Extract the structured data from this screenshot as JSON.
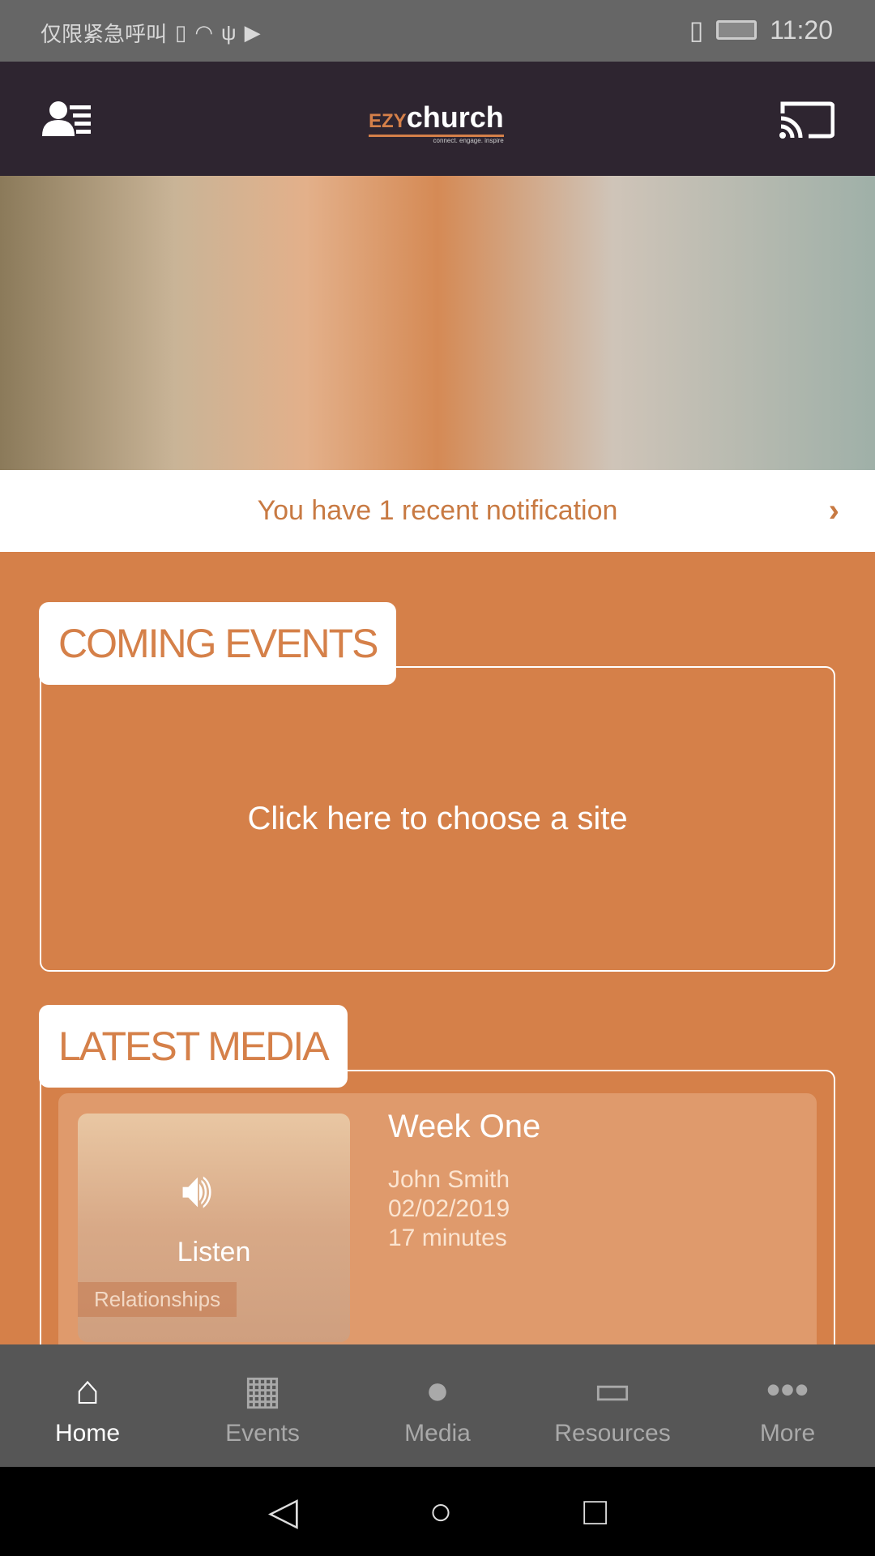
{
  "status_bar": {
    "carrier": "仅限紧急呼叫",
    "time": "11:20",
    "icons": [
      "sim-alert-icon",
      "wifi-icon",
      "usb-icon",
      "nfc-icon",
      "vibrate-icon",
      "battery-charging-icon"
    ]
  },
  "header": {
    "logo_prefix": "EZY",
    "logo_main": "church",
    "logo_tagline": "connect. engage. inspire",
    "left_icon": "profile-list-icon",
    "right_icon": "cast-icon"
  },
  "notification": {
    "text": "You have 1 recent notification"
  },
  "coming_events": {
    "title": "COMING EVENTS",
    "body": "Click here to choose a site"
  },
  "latest_media": {
    "title": "LATEST MEDIA",
    "items": [
      {
        "title": "Week One",
        "speaker": "John Smith",
        "date": "02/02/2019",
        "duration": "17 minutes",
        "action": "Listen",
        "category": "Relationships"
      }
    ]
  },
  "bottom_nav": [
    {
      "label": "Home",
      "icon": "home-icon",
      "active": true
    },
    {
      "label": "Events",
      "icon": "calendar-icon"
    },
    {
      "label": "Media",
      "icon": "microphone-icon"
    },
    {
      "label": "Resources",
      "icon": "monitor-icon"
    },
    {
      "label": "More",
      "icon": "more-dots-icon"
    }
  ],
  "colors": {
    "accent": "#d58049",
    "header": "#2e2530",
    "nav": "#565656"
  }
}
